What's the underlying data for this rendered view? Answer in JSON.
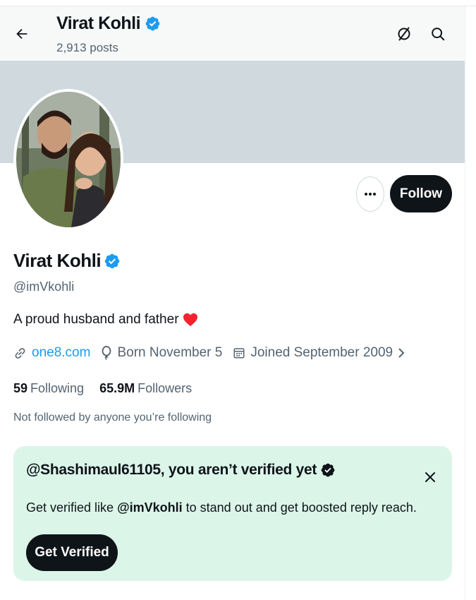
{
  "header": {
    "name": "Virat Kohli",
    "posts": "2,913 posts",
    "back_icon": "arrow-left-icon",
    "grok_icon": "grok-slash-circle-icon",
    "search_icon": "search-icon"
  },
  "profile": {
    "name": "Virat Kohli",
    "handle": "@imVkohli",
    "bio": "A proud husband and father",
    "bio_emoji": "red-heart-icon",
    "website": "one8.com",
    "born": "Born November 5",
    "joined": "Joined September 2009",
    "following_count": "59",
    "following_label": "Following",
    "followers_count": "65.9M",
    "followers_label": "Followers",
    "not_followed": "Not followed by anyone you’re following",
    "follow_button": "Follow"
  },
  "verify_card": {
    "title": "@Shashimaul61105, you aren’t verified yet",
    "text_prefix": "Get verified like ",
    "text_handle": "@imVkohli",
    "text_suffix": " to stand out and get boosted reply reach.",
    "button": "Get Verified"
  },
  "colors": {
    "accent": "#1d9bf0",
    "banner": "#cfd9de",
    "card_bg": "#dcf5e9",
    "dark": "#0f1419",
    "muted": "#536471",
    "heart": "#f4212e"
  }
}
